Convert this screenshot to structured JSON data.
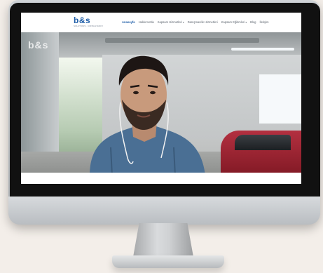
{
  "brand": {
    "logo_text": "b&s",
    "tagline": "SOLUTIONS · CONSULTANCY"
  },
  "nav": {
    "items": [
      {
        "label": "Anasayfa",
        "active": true,
        "dropdown": false
      },
      {
        "label": "Hakkımızda",
        "active": false,
        "dropdown": false
      },
      {
        "label": "Kapsam Hizmetleri",
        "active": false,
        "dropdown": true
      },
      {
        "label": "Danışmanlık Hizmetleri",
        "active": false,
        "dropdown": false
      },
      {
        "label": "Kapsam Eğitimleri",
        "active": false,
        "dropdown": true
      },
      {
        "label": "Blog",
        "active": false,
        "dropdown": false
      },
      {
        "label": "İletişim",
        "active": false,
        "dropdown": false
      }
    ]
  },
  "hero": {
    "watermark": "b&s"
  },
  "colors": {
    "brand_blue": "#1f5ea8",
    "background": "#f3eee9",
    "car_red": "#b33040"
  }
}
